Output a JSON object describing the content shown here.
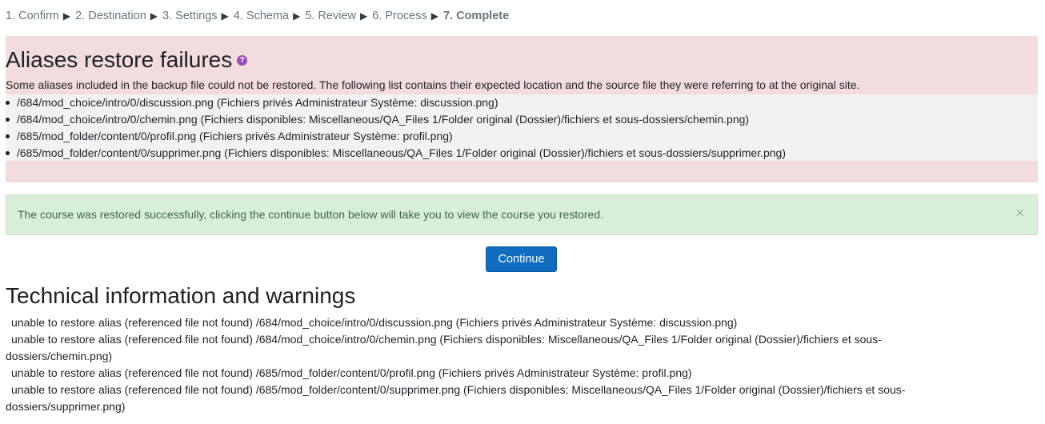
{
  "steps": [
    {
      "label": "1. Confirm"
    },
    {
      "label": "2. Destination"
    },
    {
      "label": "3. Settings"
    },
    {
      "label": "4. Schema"
    },
    {
      "label": "5. Review"
    },
    {
      "label": "6. Process"
    },
    {
      "label": "7. Complete"
    }
  ],
  "step_separator": "▶",
  "failures": {
    "title": "Aliases restore failures",
    "help_icon": "?",
    "description": "Some aliases included in the backup file could not be restored. The following list contains their expected location and the source file they were referring to at the original site.",
    "items": [
      "/684/mod_choice/intro/0/discussion.png (Fichiers privés Administrateur Système: discussion.png)",
      "/684/mod_choice/intro/0/chemin.png (Fichiers disponibles: Miscellaneous/QA_Files 1/Folder original (Dossier)/fichiers et sous-dossiers/chemin.png)",
      "/685/mod_folder/content/0/profil.png (Fichiers privés Administrateur Système: profil.png)",
      "/685/mod_folder/content/0/supprimer.png (Fichiers disponibles: Miscellaneous/QA_Files 1/Folder original (Dossier)/fichiers et sous-dossiers/supprimer.png)"
    ]
  },
  "alert": {
    "message": "The course was restored successfully, clicking the continue button below will take you to view the course you restored.",
    "close": "×"
  },
  "continue_button": "Continue",
  "technical": {
    "title": "Technical information and warnings",
    "items": [
      "unable to restore alias (referenced file not found) /684/mod_choice/intro/0/discussion.png (Fichiers privés Administrateur Système: discussion.png)",
      "unable to restore alias (referenced file not found) /684/mod_choice/intro/0/chemin.png (Fichiers disponibles: Miscellaneous/QA_Files 1/Folder original (Dossier)/fichiers et sous-dossiers/chemin.png)",
      "unable to restore alias (referenced file not found) /685/mod_folder/content/0/profil.png (Fichiers privés Administrateur Système: profil.png)",
      "unable to restore alias (referenced file not found) /685/mod_folder/content/0/supprimer.png (Fichiers disponibles: Miscellaneous/QA_Files 1/Folder original (Dossier)/fichiers et sous-dossiers/supprimer.png)"
    ]
  }
}
